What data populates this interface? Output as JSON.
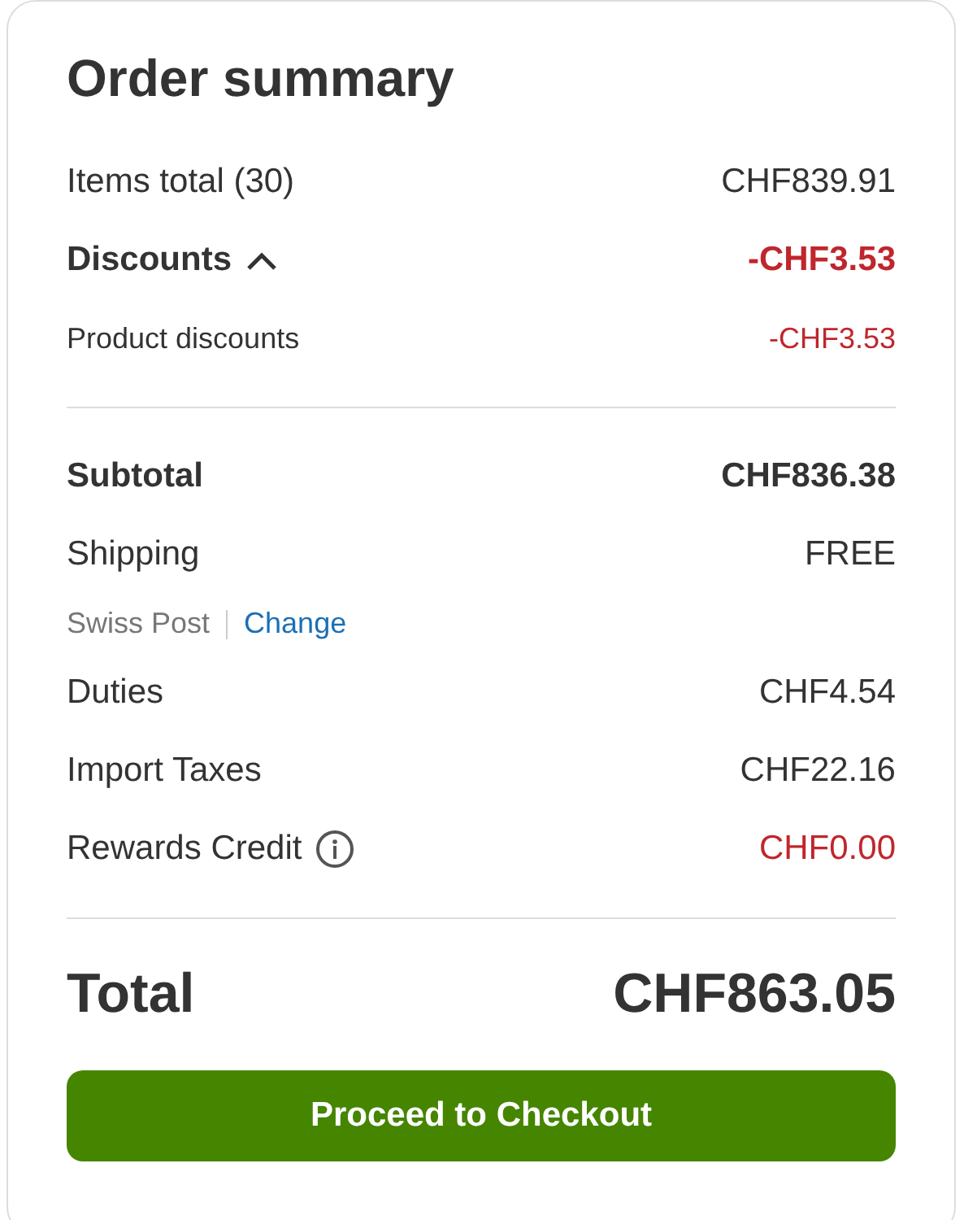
{
  "title": "Order summary",
  "sections": [
    {
      "rows": [
        {
          "kind": "plain",
          "label": "Items total (30)",
          "value": "CHF839.91",
          "color": "#333333"
        },
        {
          "kind": "group",
          "label": "Discounts",
          "value": "-CHF3.53",
          "color": "#c0262d",
          "expanded": true
        },
        {
          "kind": "detail",
          "label": "Product discounts",
          "value": "-CHF3.53",
          "color": "#c0262d"
        }
      ]
    },
    {
      "rows": [
        {
          "kind": "bold",
          "label": "Subtotal",
          "value": "CHF836.38",
          "color": "#333333"
        },
        {
          "kind": "shipping",
          "label": "Shipping",
          "value": "FREE",
          "color": "#333333",
          "carrier": "Swiss Post",
          "link": "Change"
        },
        {
          "kind": "plain",
          "label": "Duties",
          "value": "CHF4.54",
          "color": "#333333"
        },
        {
          "kind": "plain",
          "label": "Import Taxes",
          "value": "CHF22.16",
          "color": "#333333"
        },
        {
          "kind": "info",
          "label": "Rewards Credit",
          "value": "CHF0.00",
          "color": "#c0262d"
        }
      ]
    }
  ],
  "total": {
    "label": "Total",
    "value": "CHF863.05"
  },
  "button": "Proceed to Checkout"
}
